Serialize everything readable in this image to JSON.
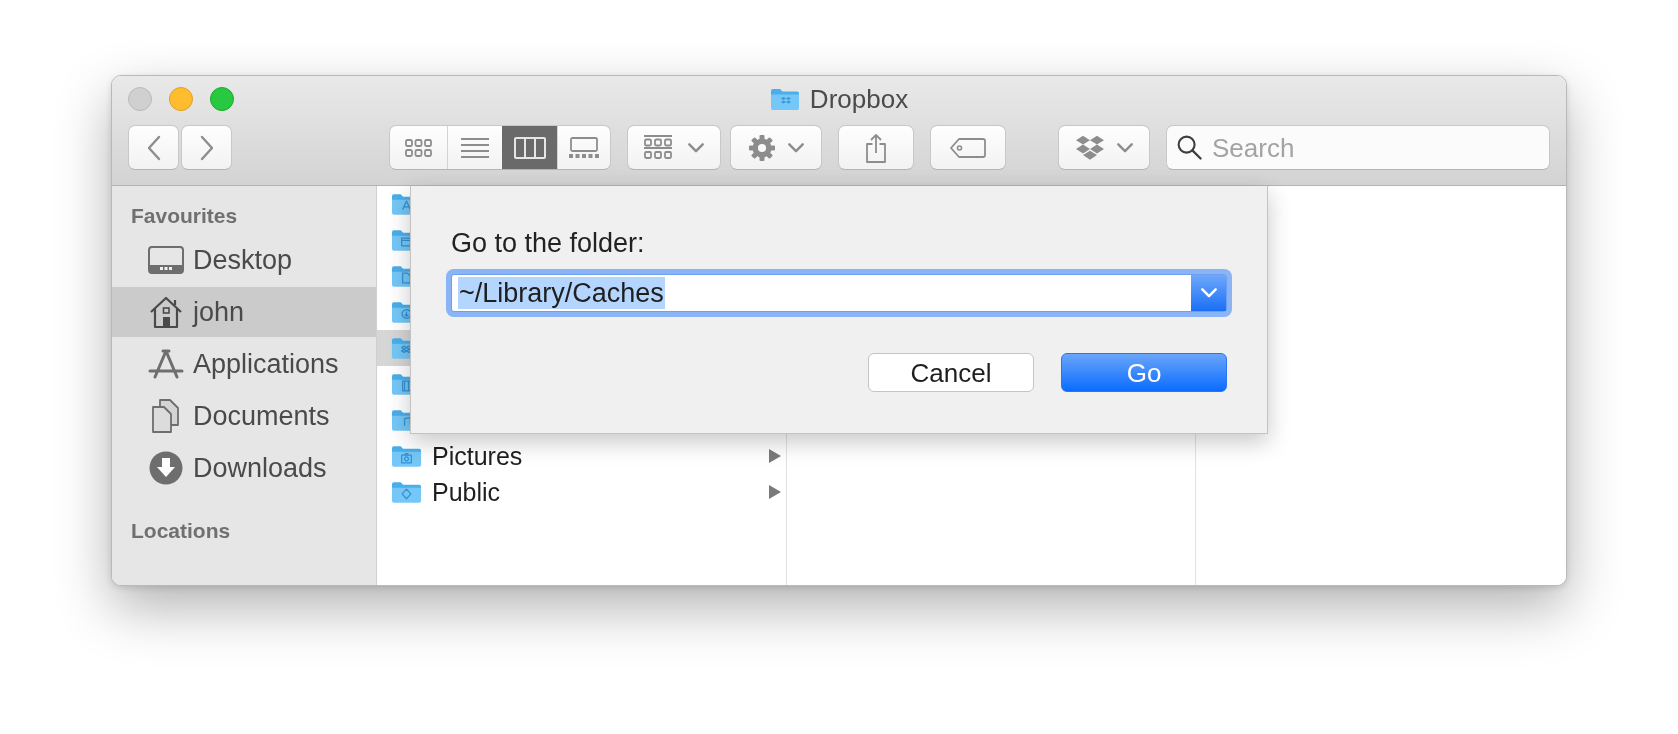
{
  "window": {
    "title": "Dropbox",
    "buttons": [
      {
        "kind": "close",
        "disabled": true
      },
      {
        "kind": "minimize",
        "disabled": false
      },
      {
        "kind": "zoom",
        "disabled": false
      }
    ]
  },
  "toolbar": {
    "view_modes": [
      {
        "kind": "icons",
        "selected": false
      },
      {
        "kind": "list",
        "selected": false
      },
      {
        "kind": "columns",
        "selected": true
      },
      {
        "kind": "gallery",
        "selected": false
      }
    ],
    "search": {
      "placeholder": "Search"
    }
  },
  "sidebar": {
    "sections": [
      {
        "title": "Favourites",
        "items": [
          {
            "label": "Desktop",
            "selected": false
          },
          {
            "label": "john",
            "selected": true
          },
          {
            "label": "Applications",
            "selected": false
          },
          {
            "label": "Documents",
            "selected": false
          },
          {
            "label": "Downloads",
            "selected": false
          }
        ]
      },
      {
        "title": "Locations"
      }
    ]
  },
  "browser": {
    "columns": [
      {
        "rows": [
          {
            "selected": false
          },
          {
            "selected": false
          },
          {
            "selected": false
          },
          {
            "selected": false
          },
          {
            "selected": true
          },
          {
            "selected": false
          },
          {
            "selected": false
          },
          {
            "name": "Pictures",
            "selected": false
          },
          {
            "name": "Public",
            "selected": false
          }
        ]
      }
    ]
  },
  "dialog": {
    "label": "Go to the folder:",
    "path": {
      "value": "~/Library/Caches",
      "focused": true,
      "highlighted": true
    },
    "buttons": [
      {
        "label": "Cancel",
        "kind": "cancel"
      },
      {
        "label": "Go",
        "kind": "confirm"
      }
    ]
  }
}
